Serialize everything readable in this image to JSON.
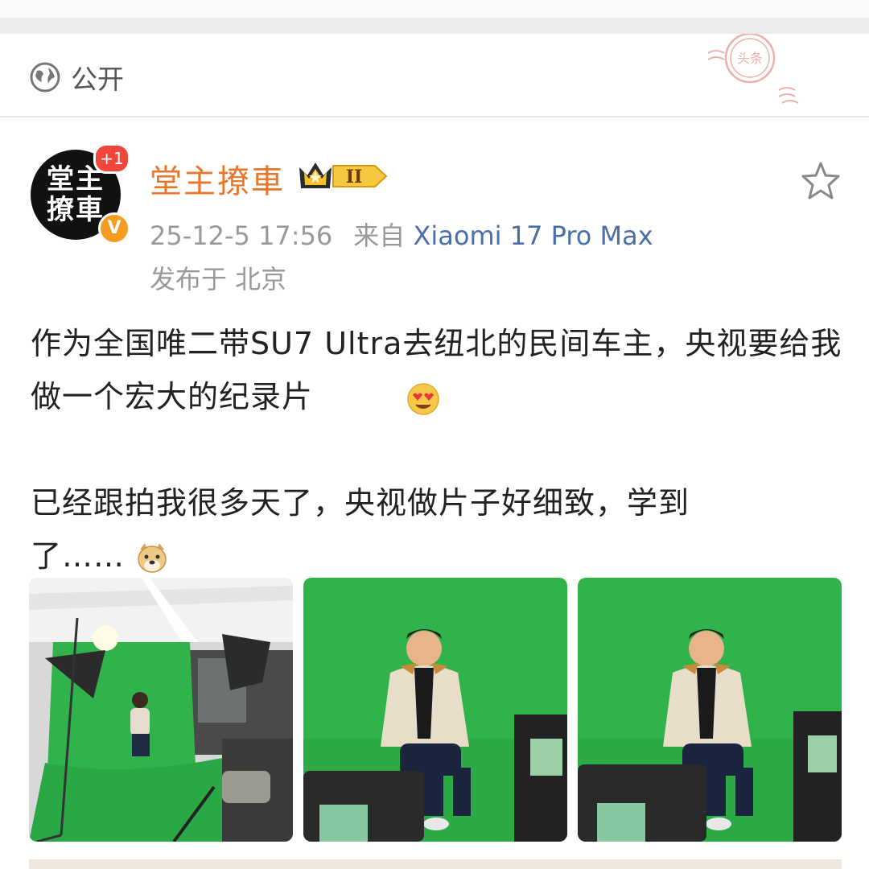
{
  "visibility": {
    "label": "公开",
    "icon": "globe-icon"
  },
  "author": {
    "name": "堂主撩車",
    "avatar_text": "堂主撩車",
    "notification_badge": "+1",
    "verified_mark": "V",
    "member_level": "II"
  },
  "post_meta": {
    "time": "25-12-5 17:56",
    "source_prefix": "来自",
    "device": "Xiaomi 17 Pro Max",
    "location": "发布于 北京"
  },
  "post": {
    "paragraph1": "作为全国唯二带SU7 Ultra去纽北的民间车主，央视要给我做一个宏大的纪录片",
    "paragraph2": "已经跟拍我很多天了，央视做片子好细致，学到了……",
    "emoji1": "heart-eyes-emoji",
    "emoji2": "doge-emoji"
  },
  "photos": [
    {
      "name": "studio-wide-shot"
    },
    {
      "name": "interview-shot-1"
    },
    {
      "name": "interview-shot-2"
    }
  ],
  "colors": {
    "username": "#e8762b",
    "device_link": "#4a6fa8",
    "greenscreen": "#2fb34a",
    "badge_red": "#f0463c",
    "verified_orange": "#f39c1f"
  },
  "watermark": {
    "text": "头条"
  }
}
